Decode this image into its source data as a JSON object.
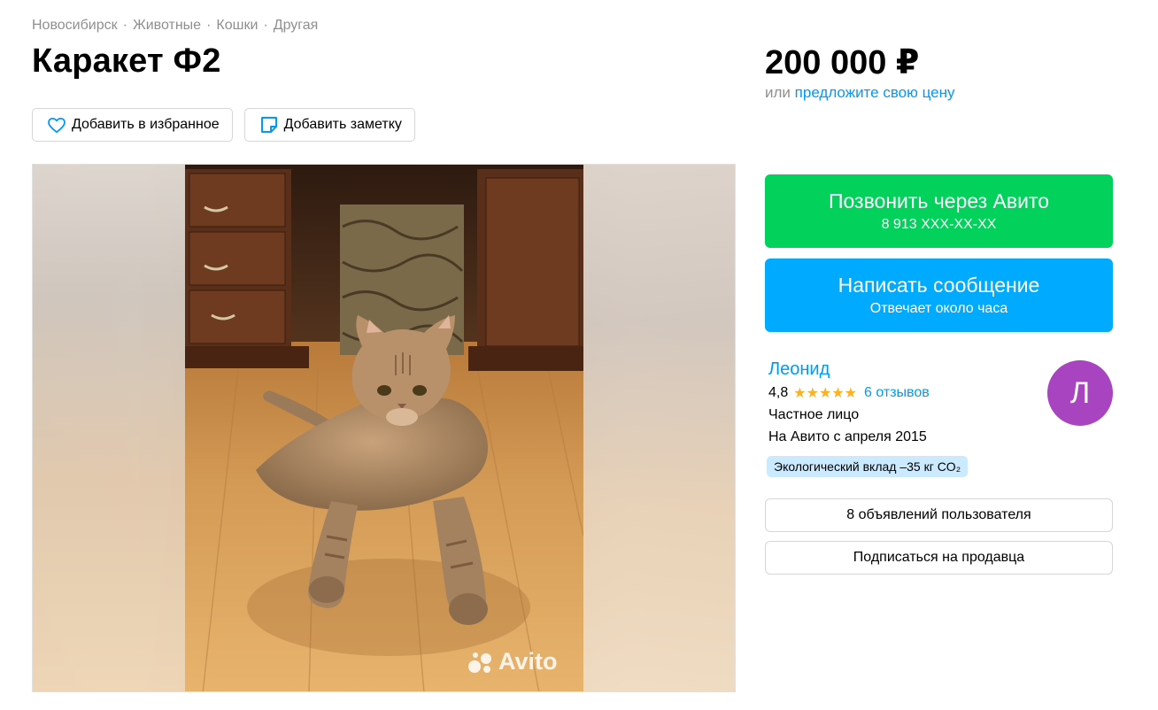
{
  "breadcrumb": {
    "items": [
      "Новосибирск",
      "Животные",
      "Кошки",
      "Другая"
    ],
    "separator": "·"
  },
  "listing": {
    "title": "Каракет Ф2",
    "favorite_label": "Добавить в избранное",
    "note_label": "Добавить заметку",
    "watermark": "Avito"
  },
  "price": {
    "value": "200 000 ₽",
    "or_text": "или",
    "offer_link": "предложите свою цену"
  },
  "contact": {
    "call_label": "Позвонить через Авито",
    "call_phone": "8 913 XXX-XX-XX",
    "message_label": "Написать сообщение",
    "message_sub": "Отвечает около часа"
  },
  "seller": {
    "name": "Леонид",
    "rating": "4,8",
    "stars": "★★★★★",
    "reviews": "6 отзывов",
    "type": "Частное лицо",
    "since": "На Авито с апреля 2015",
    "eco": "Экологический вклад –35 кг CO₂",
    "avatar_letter": "Л",
    "avatar_color": "#a944c0",
    "ads_label": "8 объявлений пользователя",
    "subscribe_label": "Подписаться на продавца"
  },
  "colors": {
    "call": "#02d15c",
    "message": "#00aaff",
    "link": "#0099f7",
    "star": "#ffb021"
  },
  "icons": {
    "favorite": "heart-outline-icon",
    "note": "note-icon"
  }
}
